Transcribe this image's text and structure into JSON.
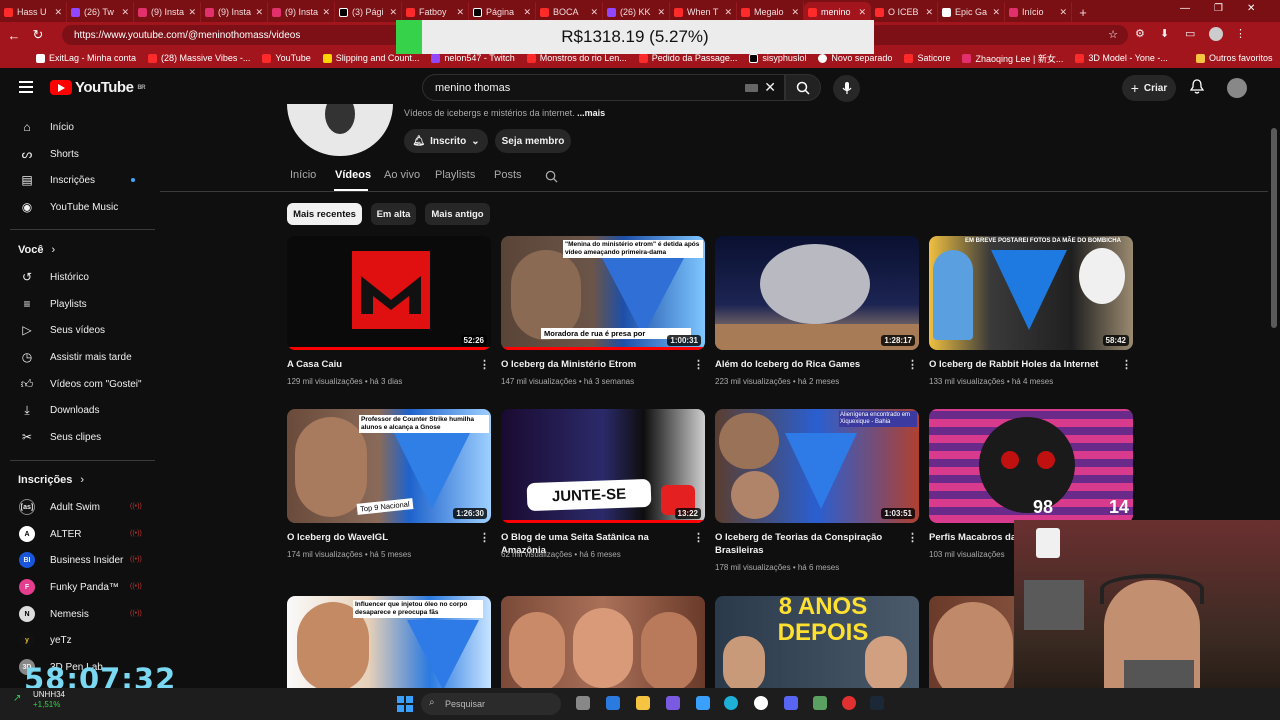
{
  "browser": {
    "tabs": [
      "Hass U",
      "(26) Tw",
      "(9) Insta",
      "(9) Insta",
      "(9) Insta",
      "(3) Pági",
      "Fatboy",
      "Página",
      "BOCA",
      "(26) KK",
      "When T",
      "Megalo",
      "menino",
      "O ICEB",
      "Epic Ga",
      "Início"
    ],
    "url": "https://www.youtube.com/@meninothomass/videos",
    "bookmarks": [
      "ExitLag - Minha conta",
      "(28) Massive Vibes -...",
      "YouTube",
      "Slipping and Count...",
      "nelon547 - Twitch",
      "Monstros do rio Len...",
      "Pedido da Passage...",
      "sisyphuslol",
      "Novo separado",
      "Saticore",
      "Zhaoqing Lee | 新女...",
      "3D Model - Yone -...",
      "Outros favoritos"
    ]
  },
  "price_overlay": "R$1318.19 (5.27%)",
  "youtube": {
    "logo": "YouTube",
    "region": "BR",
    "search_value": "menino thomas",
    "create_label": "Criar"
  },
  "sidebar": {
    "main": [
      "Início",
      "Shorts",
      "Inscrições",
      "YouTube Music"
    ],
    "you_header": "Você",
    "you": [
      "Histórico",
      "Playlists",
      "Seus vídeos",
      "Assistir mais tarde",
      "Vídeos com \"Gostei\"",
      "Downloads",
      "Seus clipes"
    ],
    "subs_header": "Inscrições",
    "subs": [
      "Adult Swim",
      "ALTER",
      "Business Insider",
      "Funky Panda™",
      "Nemesis",
      "yeTz",
      "3D Pen Lab"
    ]
  },
  "channel": {
    "description": "Vídeos de icebergs e mistérios da internet.",
    "more": "...mais",
    "subscribed": "Inscrito",
    "member": "Seja membro",
    "tabs": [
      "Início",
      "Vídeos",
      "Ao vivo",
      "Playlists",
      "Posts"
    ],
    "chips": [
      "Mais recentes",
      "Em alta",
      "Mais antigo"
    ]
  },
  "videos": [
    {
      "title": "A Casa Caiu",
      "views": "129 mil visualizações",
      "age": "há 3 dias",
      "duration": "52:26"
    },
    {
      "title": "O Iceberg da Ministério Etrom",
      "views": "147 mil visualizações",
      "age": "há 3 semanas",
      "duration": "1:00:31"
    },
    {
      "title": "Além do Iceberg do Rica Games",
      "views": "223 mil visualizações",
      "age": "há 2 meses",
      "duration": "1:28:17"
    },
    {
      "title": "O Iceberg de Rabbit Holes da Internet",
      "views": "133 mil visualizações",
      "age": "há 4 meses",
      "duration": "58:42"
    },
    {
      "title": "O Iceberg do WaveIGL",
      "views": "174 mil visualizações",
      "age": "há 5 meses",
      "duration": "1:26:30"
    },
    {
      "title": "O Blog de uma Seita Satânica na Amazônia",
      "views": "62 mil visualizações",
      "age": "há 6 meses",
      "duration": "13:22"
    },
    {
      "title": "O Iceberg de Teorias da Conspiração Brasileiras",
      "views": "178 mil visualizações",
      "age": "há 6 meses",
      "duration": "1:03:51"
    },
    {
      "title": "Perfis Macabros da I",
      "views": "103 mil visualizações",
      "age": "",
      "duration": ""
    }
  ],
  "thumb_texts": {
    "t2": "\"Menina do ministério etrom\" é detida após vídeo ameaçando primeira-dama",
    "t2b": "Moradora de rua é presa por",
    "t4": "EM BREVE POSTAREI FOTOS DA MÃE DO BOMBICHA",
    "t5": "Professor de Counter Strike humilha alunos e alcança a Gnose",
    "t5b": "Top 9 Nacional",
    "t6": "JUNTE-SE",
    "t7": "Alienígena encontrado em Xiquexique - Bahia",
    "t8a": "98",
    "t8b": "14",
    "t9": "Influencer que injetou óleo no corpo desaparece e preocupa fãs",
    "t11": "8 ANOS DEPOIS"
  },
  "overlay": {
    "timer": "58:07:32",
    "stock_symbol": "UNHH34",
    "stock_change": "+1,51%"
  },
  "taskbar": {
    "search_placeholder": "Pesquisar"
  }
}
